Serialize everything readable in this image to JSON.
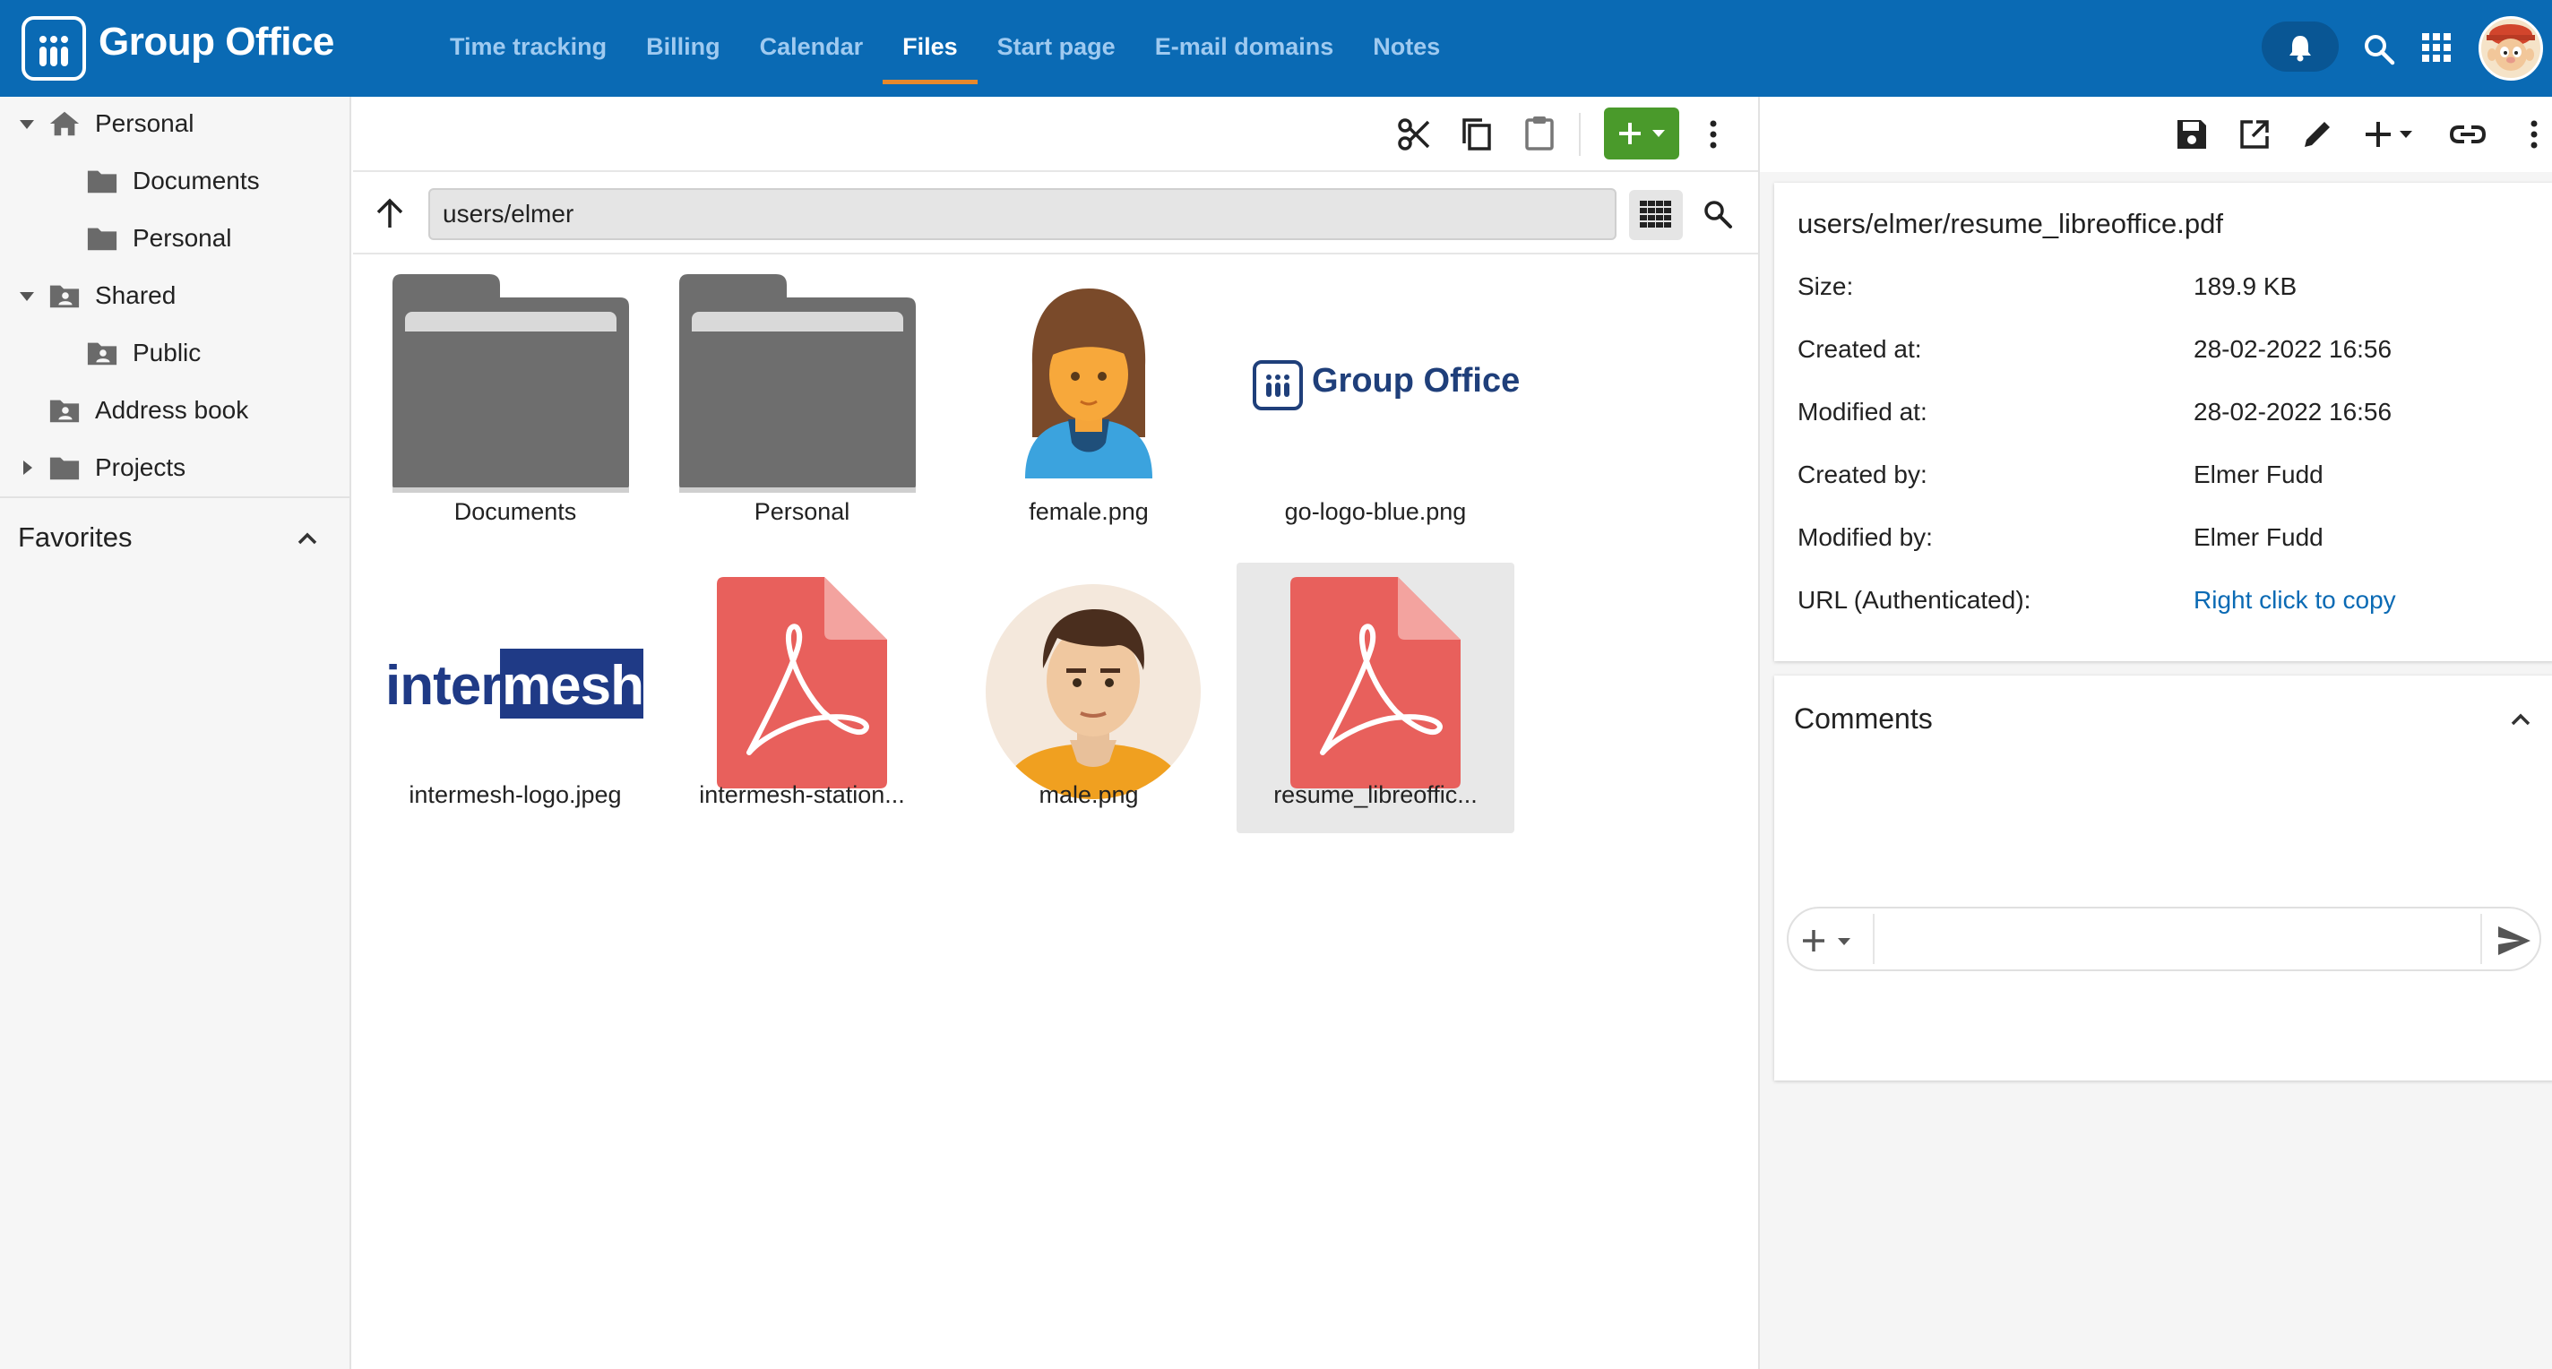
{
  "app": {
    "title": "Group Office"
  },
  "nav": {
    "items": [
      {
        "label": "Time tracking"
      },
      {
        "label": "Billing"
      },
      {
        "label": "Calendar"
      },
      {
        "label": "Files",
        "active": true
      },
      {
        "label": "Start page"
      },
      {
        "label": "E-mail domains"
      },
      {
        "label": "Notes"
      }
    ]
  },
  "topbar_icons": [
    "bell-icon",
    "search-icon",
    "apps-grid-icon",
    "user-avatar"
  ],
  "sidebar": {
    "tree": [
      {
        "label": "Personal",
        "icon": "home-icon",
        "expanded": true
      },
      {
        "label": "Documents",
        "icon": "folder-icon"
      },
      {
        "label": "Personal",
        "icon": "folder-icon"
      },
      {
        "label": "Shared",
        "icon": "shared-folder-icon",
        "expanded": true
      },
      {
        "label": "Public",
        "icon": "shared-folder-icon"
      },
      {
        "label": "Address book",
        "icon": "shared-folder-icon"
      },
      {
        "label": "Projects",
        "icon": "folder-icon",
        "expanded": false
      }
    ],
    "favorites_label": "Favorites"
  },
  "center": {
    "toolbar_icons": [
      "cut-icon",
      "copy-icon",
      "paste-icon",
      "add-icon",
      "more-vert-icon"
    ],
    "path": "users/elmer",
    "files": [
      {
        "name": "Documents",
        "type": "folder"
      },
      {
        "name": "Personal",
        "type": "folder"
      },
      {
        "name": "female.png",
        "type": "image"
      },
      {
        "name": "go-logo-blue.png",
        "type": "image",
        "logo_text": "Group Office"
      },
      {
        "name": "intermesh-logo.jpeg",
        "type": "image",
        "logo_text_a": "inter",
        "logo_text_b": "mesh"
      },
      {
        "name": "intermesh-station...",
        "type": "pdf"
      },
      {
        "name": "male.png",
        "type": "image"
      },
      {
        "name": "resume_libreoffic...",
        "type": "pdf",
        "selected": true
      }
    ]
  },
  "detail": {
    "toolbar_icons": [
      "save-icon",
      "open-external-icon",
      "edit-icon",
      "add-icon",
      "link-icon",
      "more-vert-icon"
    ],
    "title": "users/elmer/resume_libreoffice.pdf",
    "rows": [
      {
        "key": "Size:",
        "value": "189.9 KB"
      },
      {
        "key": "Created at:",
        "value": "28-02-2022 16:56"
      },
      {
        "key": "Modified at:",
        "value": "28-02-2022 16:56"
      },
      {
        "key": "Created by:",
        "value": "Elmer Fudd"
      },
      {
        "key": "Modified by:",
        "value": "Elmer Fudd"
      },
      {
        "key": "URL (Authenticated):",
        "value": "Right click to copy"
      }
    ],
    "comments_title": "Comments"
  },
  "colors": {
    "topbar": "#0a6ab4",
    "active_underline": "#e8882b",
    "add_button": "#4a9a2b",
    "pdf": "#e8605c",
    "folder": "#6e6e6e",
    "link": "#0a6ab4"
  }
}
